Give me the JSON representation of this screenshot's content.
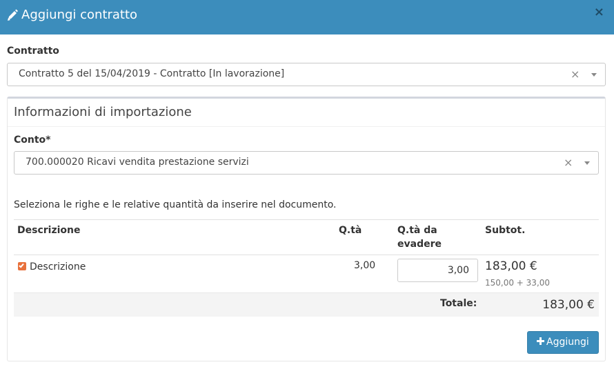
{
  "modal": {
    "title": "Aggiungi contratto",
    "close_label": "×",
    "header_color": "#3c8dbc"
  },
  "contract": {
    "label": "Contratto",
    "selected": "Contratto 5 del 15/04/2019 - Contratto [In lavorazione]",
    "clear_label": "×"
  },
  "import_info": {
    "title": "Informazioni di importazione",
    "account_label": "Conto*",
    "account_selected": "700.000020 Ricavi vendita prestazione servizi",
    "clear_label": "×",
    "instructions": "Seleziona le righe e le relative quantità da inserire nel documento."
  },
  "table": {
    "headers": {
      "description": "Descrizione",
      "qty": "Q.tà",
      "qty_to_process": "Q.tà da evadere",
      "subtotal": "Subtot."
    },
    "rows": [
      {
        "checked": true,
        "description": "Descrizione",
        "qty": "3,00",
        "qty_to_process": "3,00",
        "subtotal": "183,00 €",
        "subtotal_detail": "150,00 + 33,00"
      }
    ],
    "total_label": "Totale:",
    "total_value": "183,00 €"
  },
  "actions": {
    "add_label": "Aggiungi",
    "add_icon": "plus-icon"
  },
  "colors": {
    "accent": "#3c8dbc",
    "checkbox": "#e8713c"
  }
}
